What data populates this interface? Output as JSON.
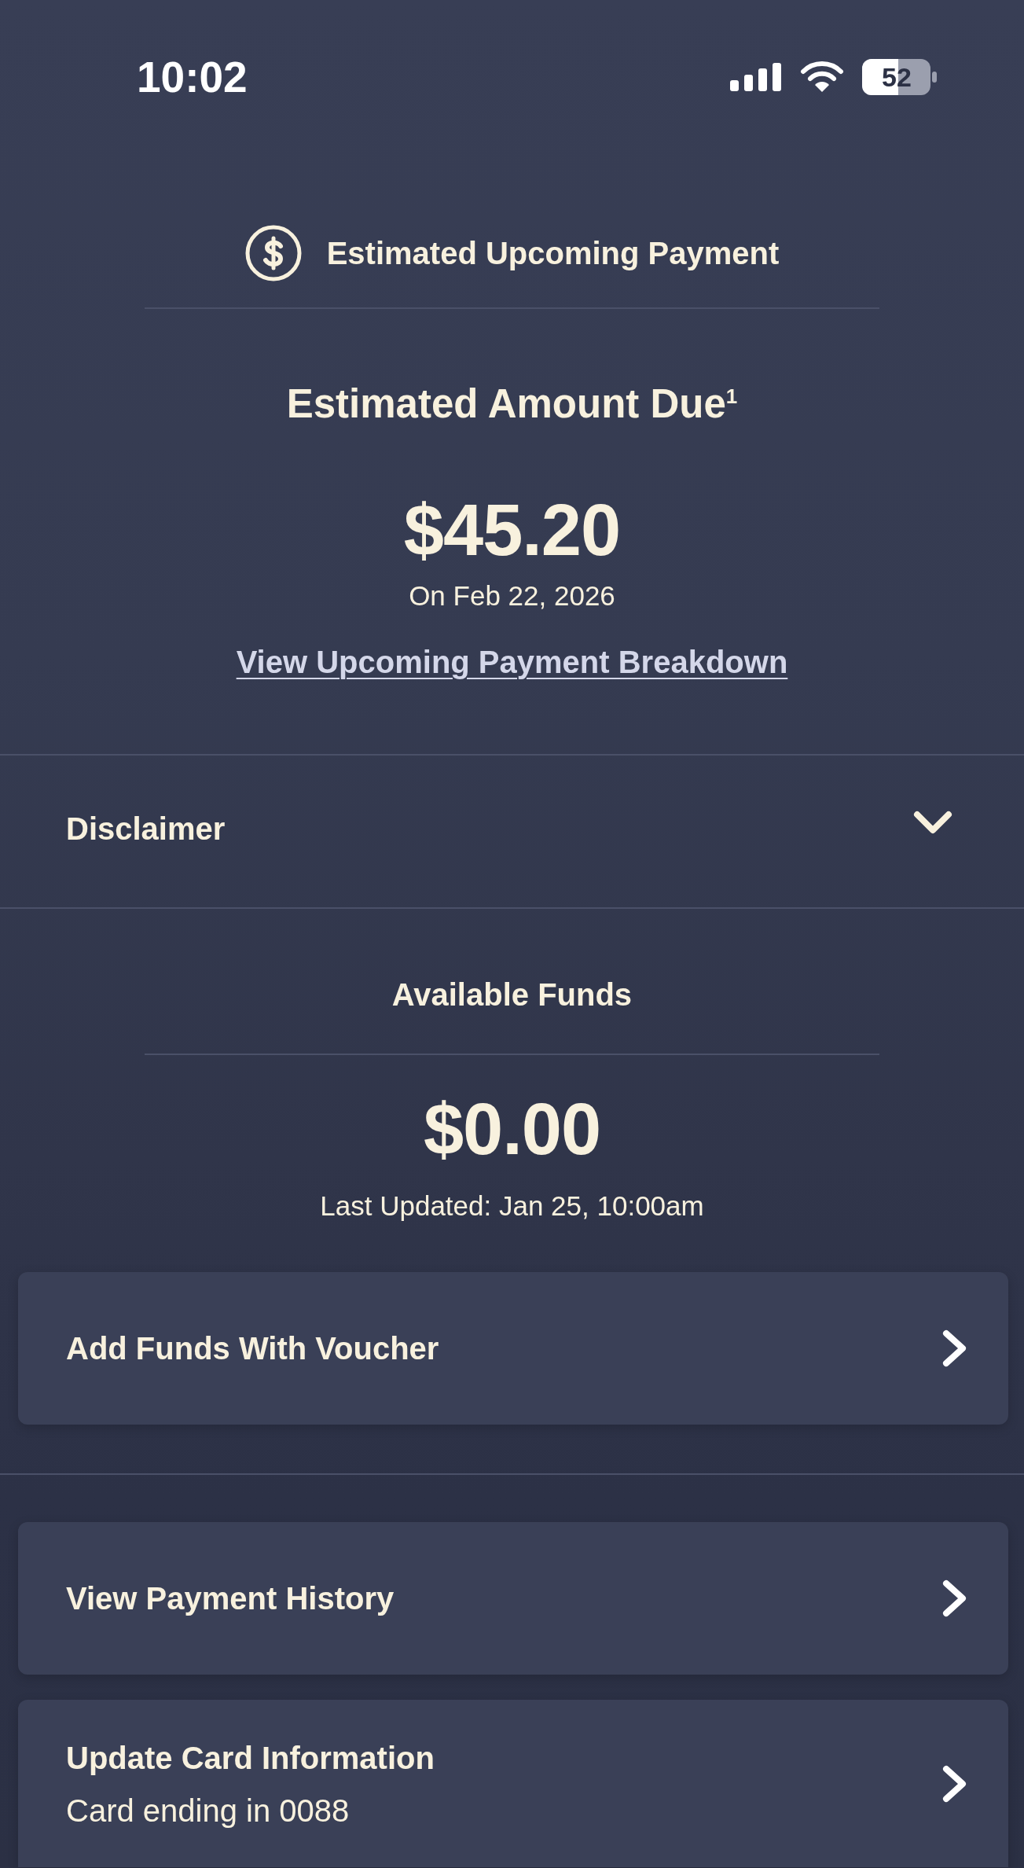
{
  "status_bar": {
    "time": "10:02",
    "battery": "52"
  },
  "payment_header": {
    "title": "Estimated Upcoming Payment"
  },
  "amount_due": {
    "label": "Estimated Amount Due$^{1}$",
    "amount": "$45.20",
    "date": "On Feb 22, 2026",
    "link": "View Upcoming Payment Breakdown"
  },
  "disclaimer": {
    "label": "Disclaimer",
    "expanded": false
  },
  "available_funds": {
    "title": "Available Funds",
    "amount": "$0.00",
    "updated": "Last Updated: Jan 25, 10:00am"
  },
  "fund_actions": [
    {
      "label": "Add Funds With Voucher"
    }
  ],
  "account_actions": [
    {
      "label": "View Payment History"
    },
    {
      "label": "Update Card Information",
      "detail": "Card ending in 0088"
    }
  ]
}
